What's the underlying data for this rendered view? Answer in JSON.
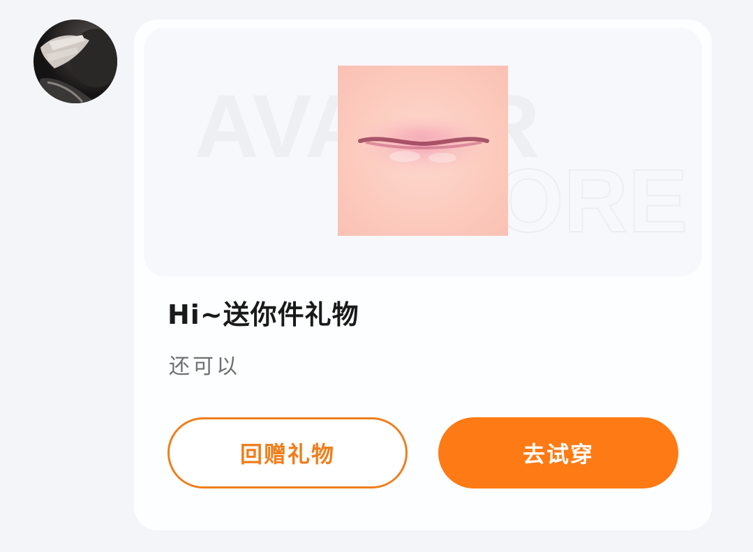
{
  "sender": {
    "avatar_icon": "user-photo"
  },
  "gift_card": {
    "watermark_line1": "AVATAR",
    "watermark_line2": "STORE",
    "gift_icon": "lip-makeup",
    "title": "Hi~送你件礼物",
    "subtitle": "还可以",
    "return_gift_label": "回赠礼物",
    "try_on_label": "去试穿"
  },
  "colors": {
    "background": "#f4f5f9",
    "card": "#fdfeff",
    "accent_orange": "#fd7a14",
    "outline_orange": "#ef7e1c",
    "title_text": "#1a1a1a",
    "subtitle_text": "#6f6f6f"
  }
}
